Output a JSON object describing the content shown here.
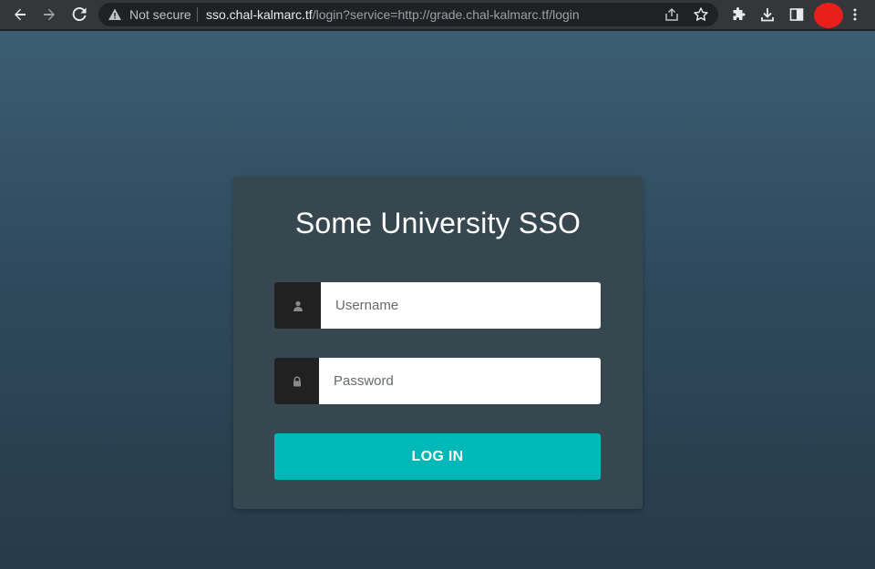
{
  "browser": {
    "security_label": "Not secure",
    "url_host": "sso.chal-kalmarc.tf",
    "url_rest": "/login?service=http://grade.chal-kalmarc.tf/login",
    "icons": {
      "back": "back-arrow-icon",
      "forward": "forward-arrow-icon",
      "reload": "reload-icon",
      "warning": "warning-icon",
      "share": "share-icon",
      "bookmark": "star-icon",
      "extensions": "puzzle-icon",
      "download": "download-icon",
      "side_panel": "side-panel-icon",
      "menu": "kebab-menu-icon"
    },
    "profile_color": "#e8201c"
  },
  "login": {
    "title": "Some University SSO",
    "username_placeholder": "Username",
    "password_placeholder": "Password",
    "submit_label": "LOG IN",
    "accent_color": "#00b8b8",
    "icons": {
      "username": "user-icon",
      "password": "lock-icon"
    }
  }
}
